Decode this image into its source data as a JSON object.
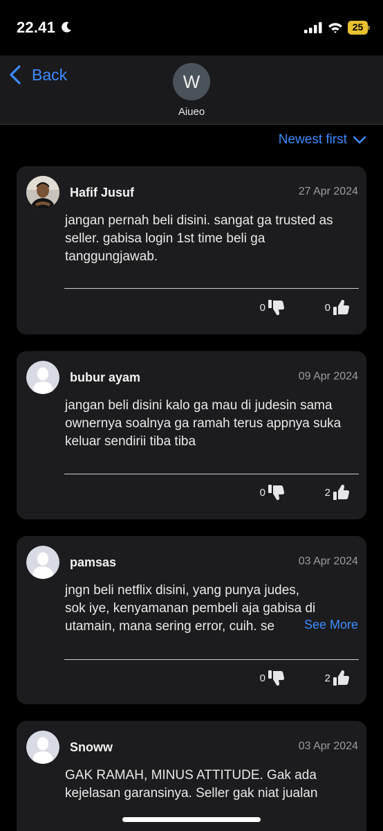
{
  "status_bar": {
    "time": "22.41",
    "battery": "25",
    "icons": [
      "moon-icon",
      "cellular-signal-icon",
      "wifi-icon",
      "battery-charging-icon"
    ]
  },
  "header": {
    "back_label": "Back",
    "store_initial": "W",
    "store_name": "Aiueo"
  },
  "sort": {
    "label": "Newest first"
  },
  "colors": {
    "accent": "#3d8bff",
    "card": "#1c1c1e",
    "background": "#000000",
    "battery": "#e6c02f"
  },
  "reviews": [
    {
      "name": "Hafif Jusuf",
      "date": "27 Apr 2024",
      "text": "jangan pernah beli disini. sangat ga trusted as seller. gabisa login 1st time beli ga tanggungjawab.",
      "dislikes": "0",
      "likes": "0",
      "avatar": "photo"
    },
    {
      "name": "bubur ayam",
      "date": "09 Apr 2024",
      "text": "jangan beli disini kalo ga mau di judesin sama ownernya soalnya ga ramah terus appnya suka keluar sendirii tiba tiba",
      "dislikes": "0",
      "likes": "2",
      "avatar": "default"
    },
    {
      "name": "pamsas",
      "date": "03 Apr 2024",
      "text_line1": "jngn beli netflix disini, yang punya judes,",
      "text_line2": "sok iye, kenyamanan pembeli aja gabisa di",
      "text_line3": "utamain, mana sering error, cuih. se",
      "see_more": "See More",
      "dislikes": "0",
      "likes": "2",
      "avatar": "default"
    },
    {
      "name": "Snoww",
      "date": "03 Apr 2024",
      "text": "GAK RAMAH, MINUS ATTITUDE. Gak ada kejelasan garansinya. Seller gak niat jualan",
      "avatar": "default"
    }
  ]
}
